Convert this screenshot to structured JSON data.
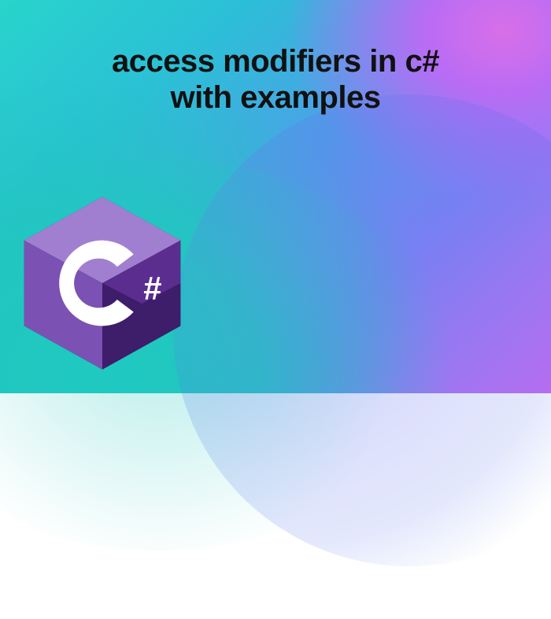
{
  "title_line1": "access modifiers in c#",
  "title_line2": "with examples",
  "logo": {
    "name": "csharp-logo",
    "hash_text": "#",
    "colors": {
      "hex_top": "#a17fd0",
      "hex_left": "#7b52b3",
      "hex_right_top": "#5b2d8f",
      "hex_right_bottom": "#3e1d6b",
      "c_letter": "#ffffff"
    }
  }
}
